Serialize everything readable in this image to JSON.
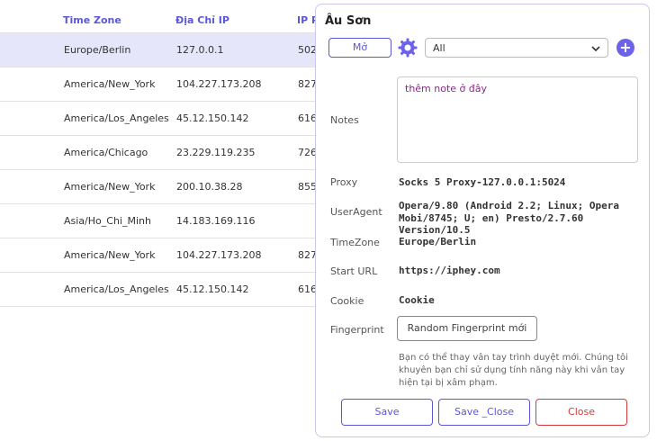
{
  "table": {
    "headers": [
      "Time Zone",
      "Địa Chỉ IP",
      "IP P"
    ],
    "rows": [
      {
        "tz": "Europe/Berlin",
        "ip": "127.0.0.1",
        "port": "502"
      },
      {
        "tz": "America/New_York",
        "ip": "104.227.173.208",
        "port": "827"
      },
      {
        "tz": "America/Los_Angeles",
        "ip": "45.12.150.142",
        "port": "616"
      },
      {
        "tz": "America/Chicago",
        "ip": "23.229.119.235",
        "port": "726"
      },
      {
        "tz": "America/New_York",
        "ip": "200.10.38.28",
        "port": "855"
      },
      {
        "tz": "Asia/Ho_Chi_Minh",
        "ip": "14.183.169.116",
        "port": ""
      },
      {
        "tz": "America/New_York",
        "ip": "104.227.173.208",
        "port": "827"
      },
      {
        "tz": "America/Los_Angeles",
        "ip": "45.12.150.142",
        "port": "616"
      }
    ]
  },
  "panel": {
    "title": "Âu Sơn",
    "open_label": "Mở",
    "select_value": "All",
    "notes_label": "Notes",
    "notes_value": "thêm note ở đây",
    "proxy_label": "Proxy",
    "proxy_value": "Socks 5 Proxy-127.0.0.1:5024",
    "ua_label": "UserAgent",
    "ua_line1": "Opera/9.80 (Android 2.2; Linux; Opera",
    "ua_line2": "Mobi/8745; U; en) Presto/2.7.60 Version/10.5",
    "tz_label": "TimeZone",
    "tz_value": "Europe/Berlin",
    "url_label": "Start URL",
    "url_value": "https://iphey.com",
    "cookie_label": "Cookie",
    "cookie_value": "Cookie",
    "fp_label": "Fingerprint",
    "fp_button": "Random Fingerprint mới",
    "hint": "Bạn có thể thay vân tay trình duyệt mới. Chúng tôi khuyên bạn chỉ sử dụng tính năng này khi vân tay hiện tại bị xâm phạm.",
    "save": "Save",
    "save_close": "Save _Close",
    "close": "Close"
  },
  "colors": {
    "accent": "#5b57d6",
    "danger": "#d23b3b",
    "selected_row": "#e6e6fb"
  }
}
